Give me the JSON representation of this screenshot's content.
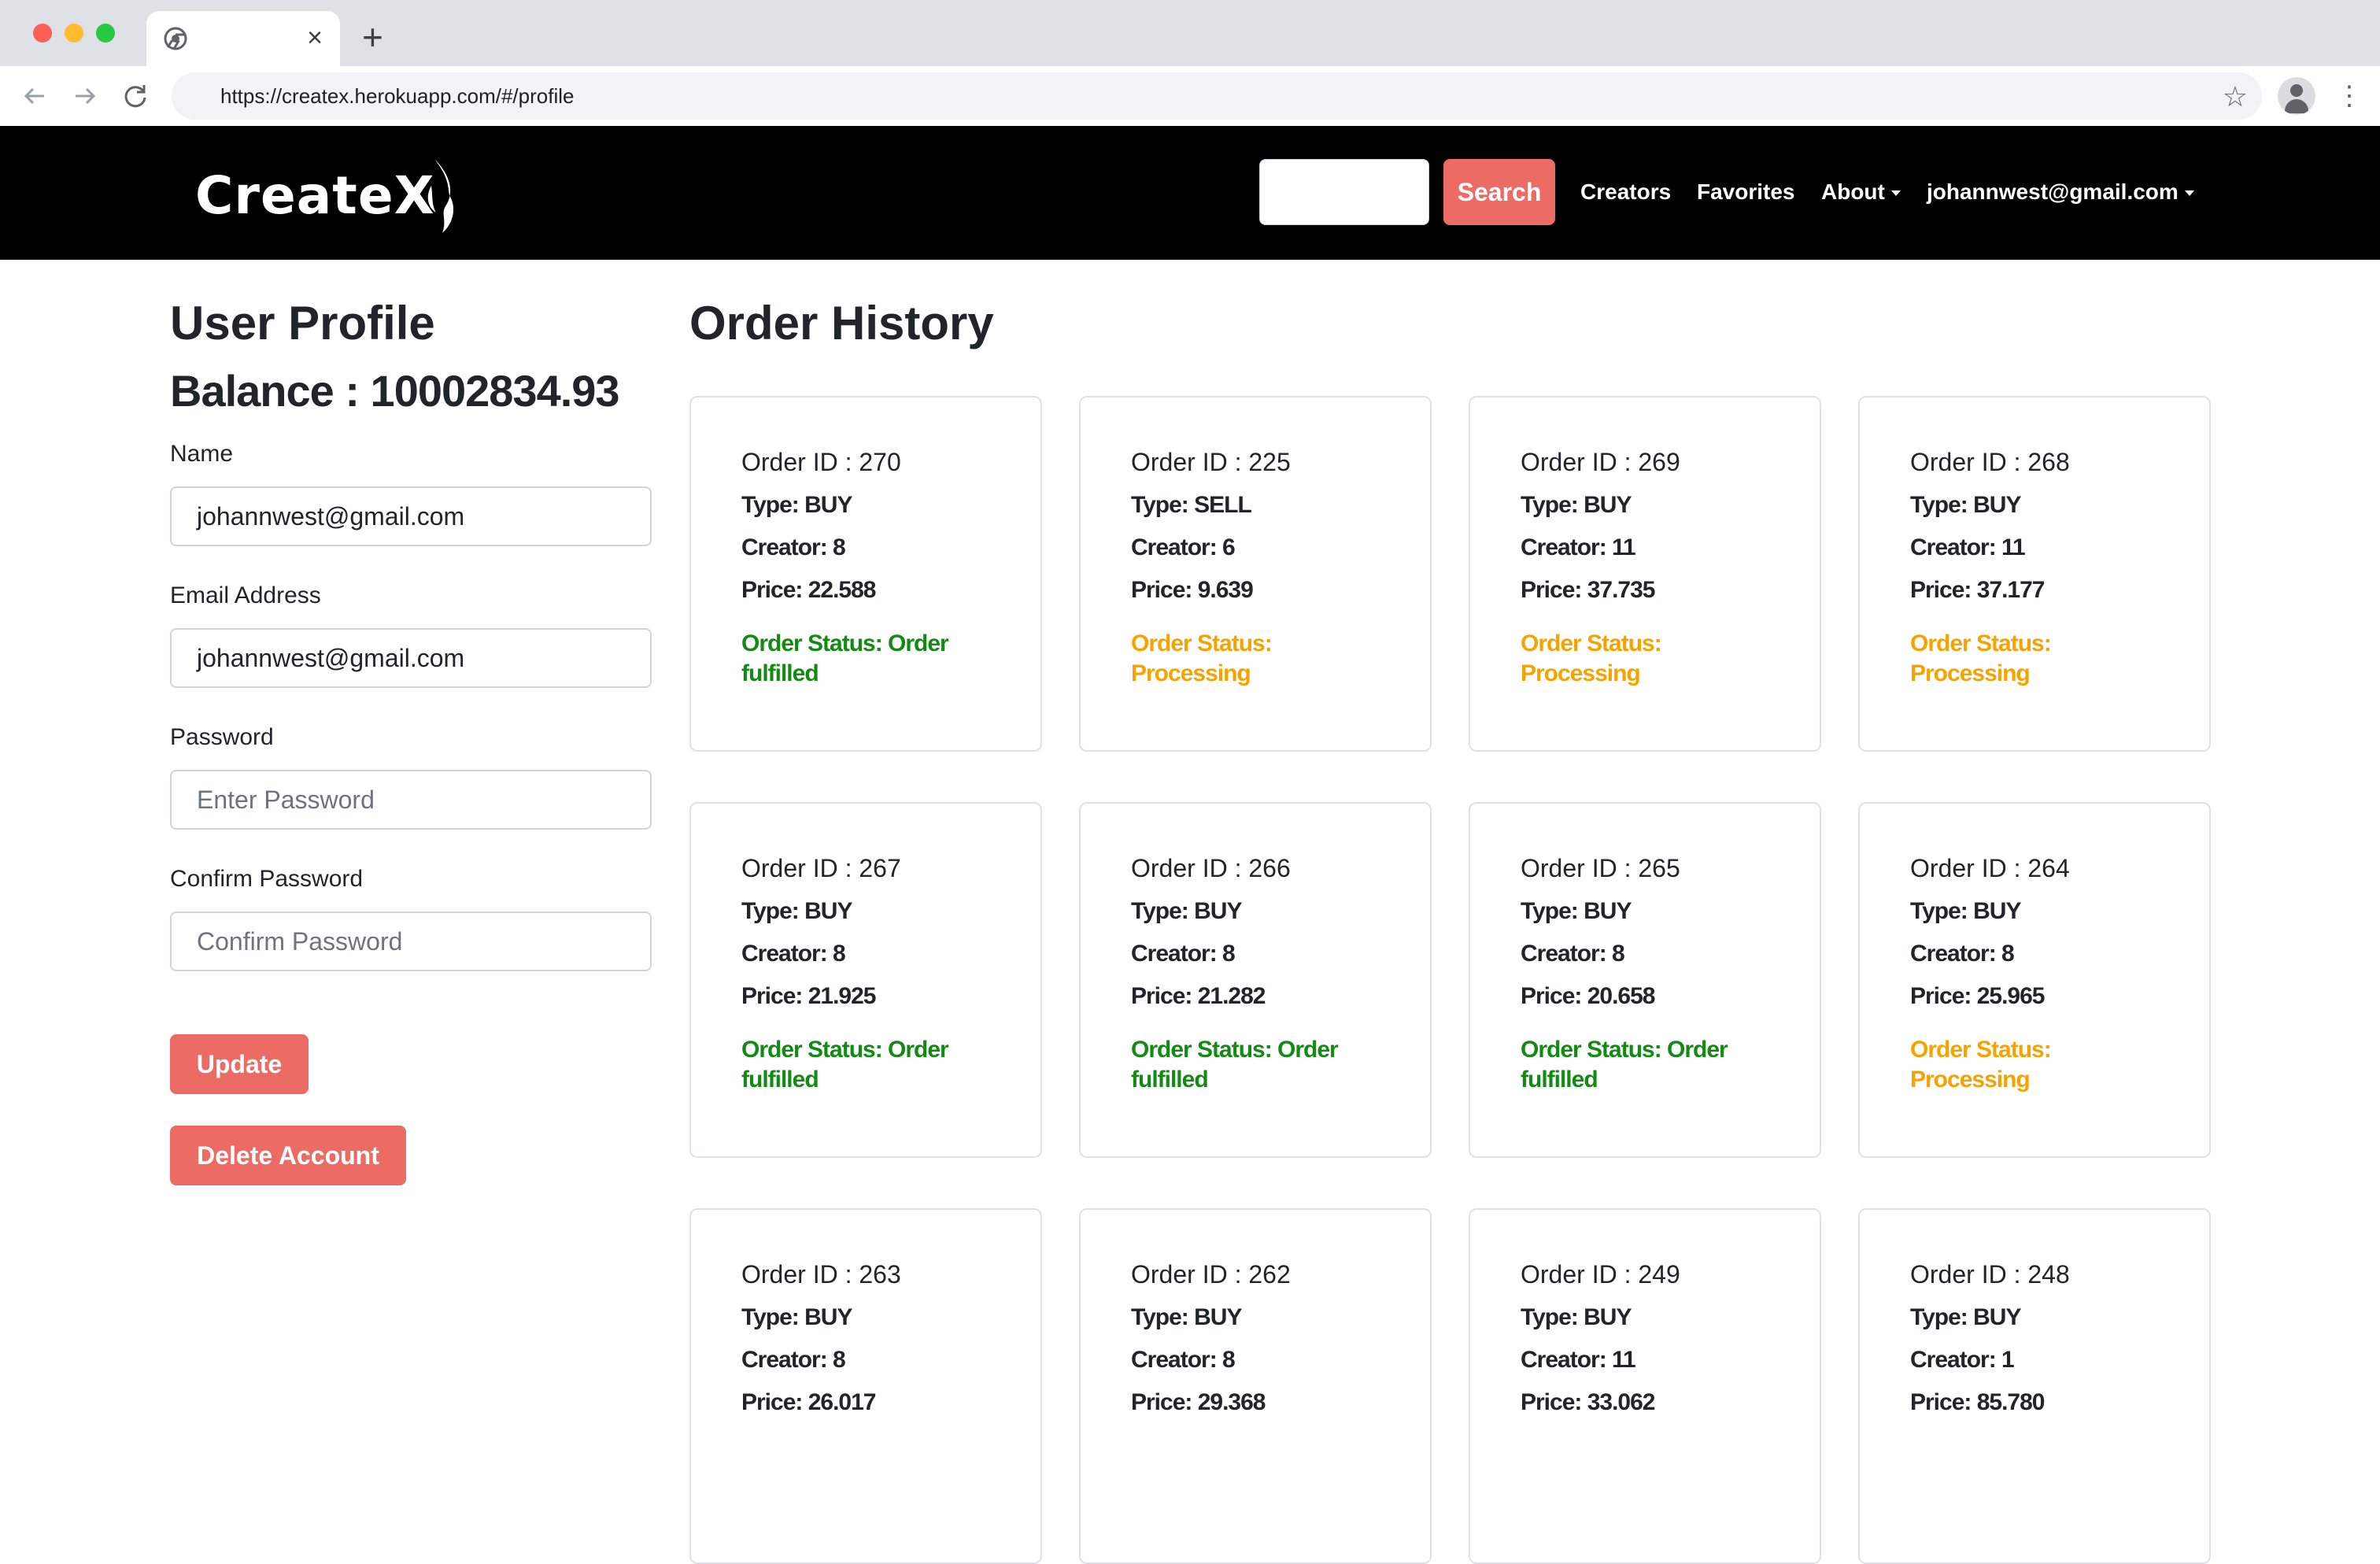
{
  "browser": {
    "url": "https://createx.herokuapp.com/#/profile",
    "tab_close": "×",
    "new_tab": "+",
    "icons": [
      "chrome-icon",
      "back-arrow-icon",
      "forward-arrow-icon",
      "reload-icon",
      "star-icon",
      "profile-icon",
      "kebab-menu-icon"
    ]
  },
  "navbar": {
    "logo": "CreateX",
    "search_placeholder": "",
    "search_label": "Search",
    "links": {
      "creators": "Creators",
      "favorites": "Favorites",
      "about": "About",
      "account": "johannwest@gmail.com"
    }
  },
  "profile": {
    "title": "User Profile",
    "balance": "Balance : 10002834.93",
    "name_label": "Name",
    "name_value": "johannwest@gmail.com",
    "email_label": "Email Address",
    "email_value": "johannwest@gmail.com",
    "password_label": "Password",
    "password_placeholder": "Enter Password",
    "confirm_label": "Confirm Password",
    "confirm_placeholder": "Confirm Password",
    "update_label": "Update",
    "delete_label": "Delete Account"
  },
  "orders": {
    "title": "Order History",
    "items": [
      {
        "id": "Order ID : 270",
        "type": "Type: BUY",
        "creator": "Creator: 8",
        "price": "Price: 22.588",
        "status": "Order Status: Order fulfilled",
        "status_kind": "fulfilled"
      },
      {
        "id": "Order ID : 225",
        "type": "Type: SELL",
        "creator": "Creator: 6",
        "price": "Price: 9.639",
        "status": "Order Status: Processing",
        "status_kind": "processing"
      },
      {
        "id": "Order ID : 269",
        "type": "Type: BUY",
        "creator": "Creator: 11",
        "price": "Price: 37.735",
        "status": "Order Status: Processing",
        "status_kind": "processing"
      },
      {
        "id": "Order ID : 268",
        "type": "Type: BUY",
        "creator": "Creator: 11",
        "price": "Price: 37.177",
        "status": "Order Status: Processing",
        "status_kind": "processing"
      },
      {
        "id": "Order ID : 267",
        "type": "Type: BUY",
        "creator": "Creator: 8",
        "price": "Price: 21.925",
        "status": "Order Status: Order fulfilled",
        "status_kind": "fulfilled"
      },
      {
        "id": "Order ID : 266",
        "type": "Type: BUY",
        "creator": "Creator: 8",
        "price": "Price: 21.282",
        "status": "Order Status: Order fulfilled",
        "status_kind": "fulfilled"
      },
      {
        "id": "Order ID : 265",
        "type": "Type: BUY",
        "creator": "Creator: 8",
        "price": "Price: 20.658",
        "status": "Order Status: Order fulfilled",
        "status_kind": "fulfilled"
      },
      {
        "id": "Order ID : 264",
        "type": "Type: BUY",
        "creator": "Creator: 8",
        "price": "Price: 25.965",
        "status": "Order Status: Processing",
        "status_kind": "processing"
      },
      {
        "id": "Order ID : 263",
        "type": "Type: BUY",
        "creator": "Creator: 8",
        "price": "Price: 26.017",
        "status": "",
        "status_kind": ""
      },
      {
        "id": "Order ID : 262",
        "type": "Type: BUY",
        "creator": "Creator: 8",
        "price": "Price: 29.368",
        "status": "",
        "status_kind": ""
      },
      {
        "id": "Order ID : 249",
        "type": "Type: BUY",
        "creator": "Creator: 11",
        "price": "Price: 33.062",
        "status": "",
        "status_kind": ""
      },
      {
        "id": "Order ID : 248",
        "type": "Type: BUY",
        "creator": "Creator: 1",
        "price": "Price: 85.780",
        "status": "",
        "status_kind": ""
      }
    ]
  },
  "colors": {
    "accent": "#ec6b65",
    "navbar_bg": "#000000",
    "fulfilled": "#138a13",
    "processing": "#f5a300"
  }
}
